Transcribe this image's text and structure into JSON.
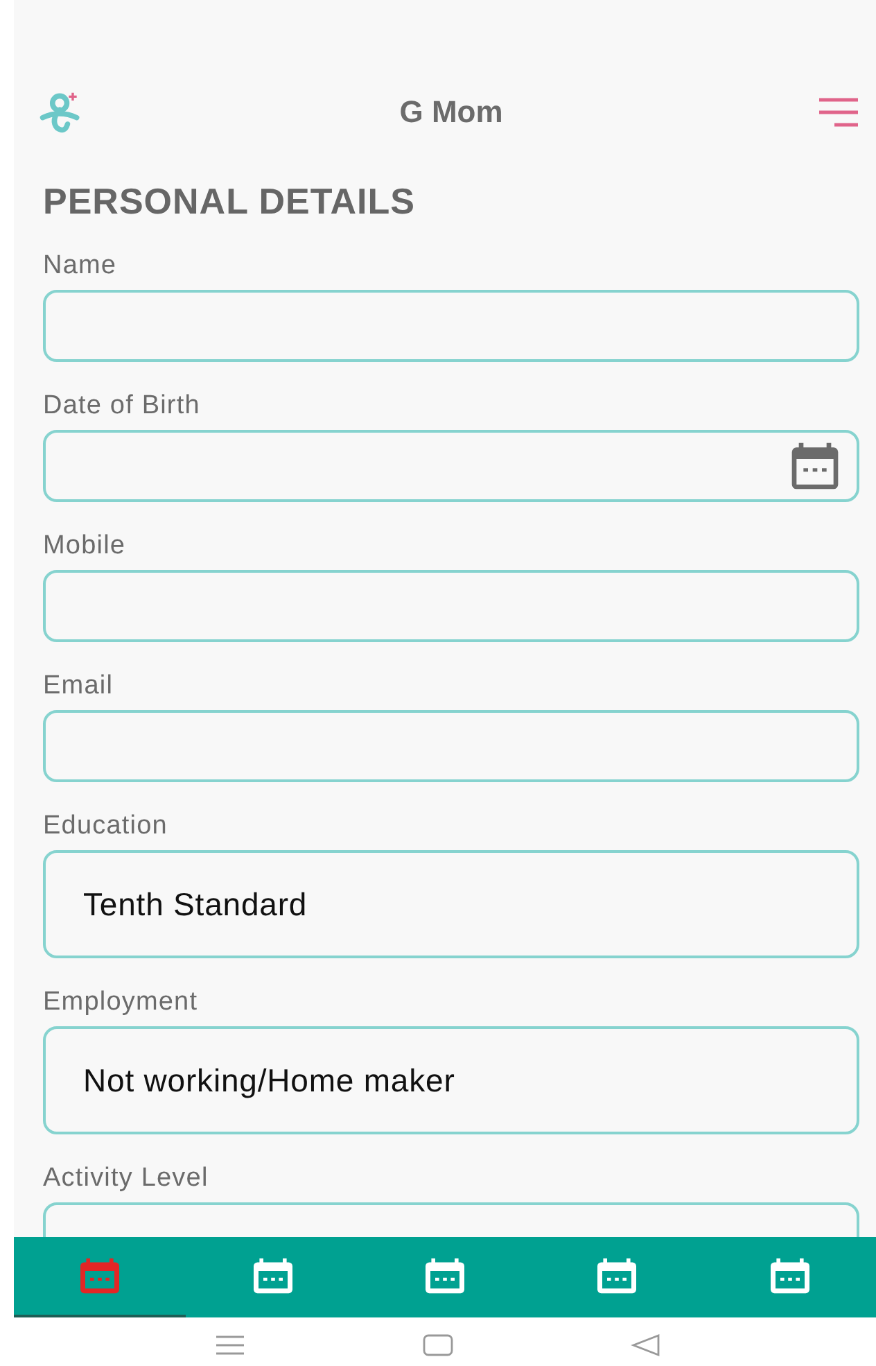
{
  "header": {
    "title": "G Mom"
  },
  "section_title": "PERSONAL DETAILS",
  "fields": [
    {
      "label": "Name",
      "kind": "text"
    },
    {
      "label": "Date of Birth",
      "kind": "date"
    },
    {
      "label": "Mobile",
      "kind": "text"
    },
    {
      "label": "Email",
      "kind": "text"
    },
    {
      "label": "Education",
      "kind": "select",
      "value": "Tenth Standard"
    },
    {
      "label": "Employment",
      "kind": "select",
      "value": "Not working/Home maker"
    },
    {
      "label": "Activity Level",
      "kind": "select"
    }
  ],
  "bottom_nav": [
    {
      "selected": true
    },
    {
      "selected": false
    },
    {
      "selected": false
    },
    {
      "selected": false
    },
    {
      "selected": false
    }
  ]
}
